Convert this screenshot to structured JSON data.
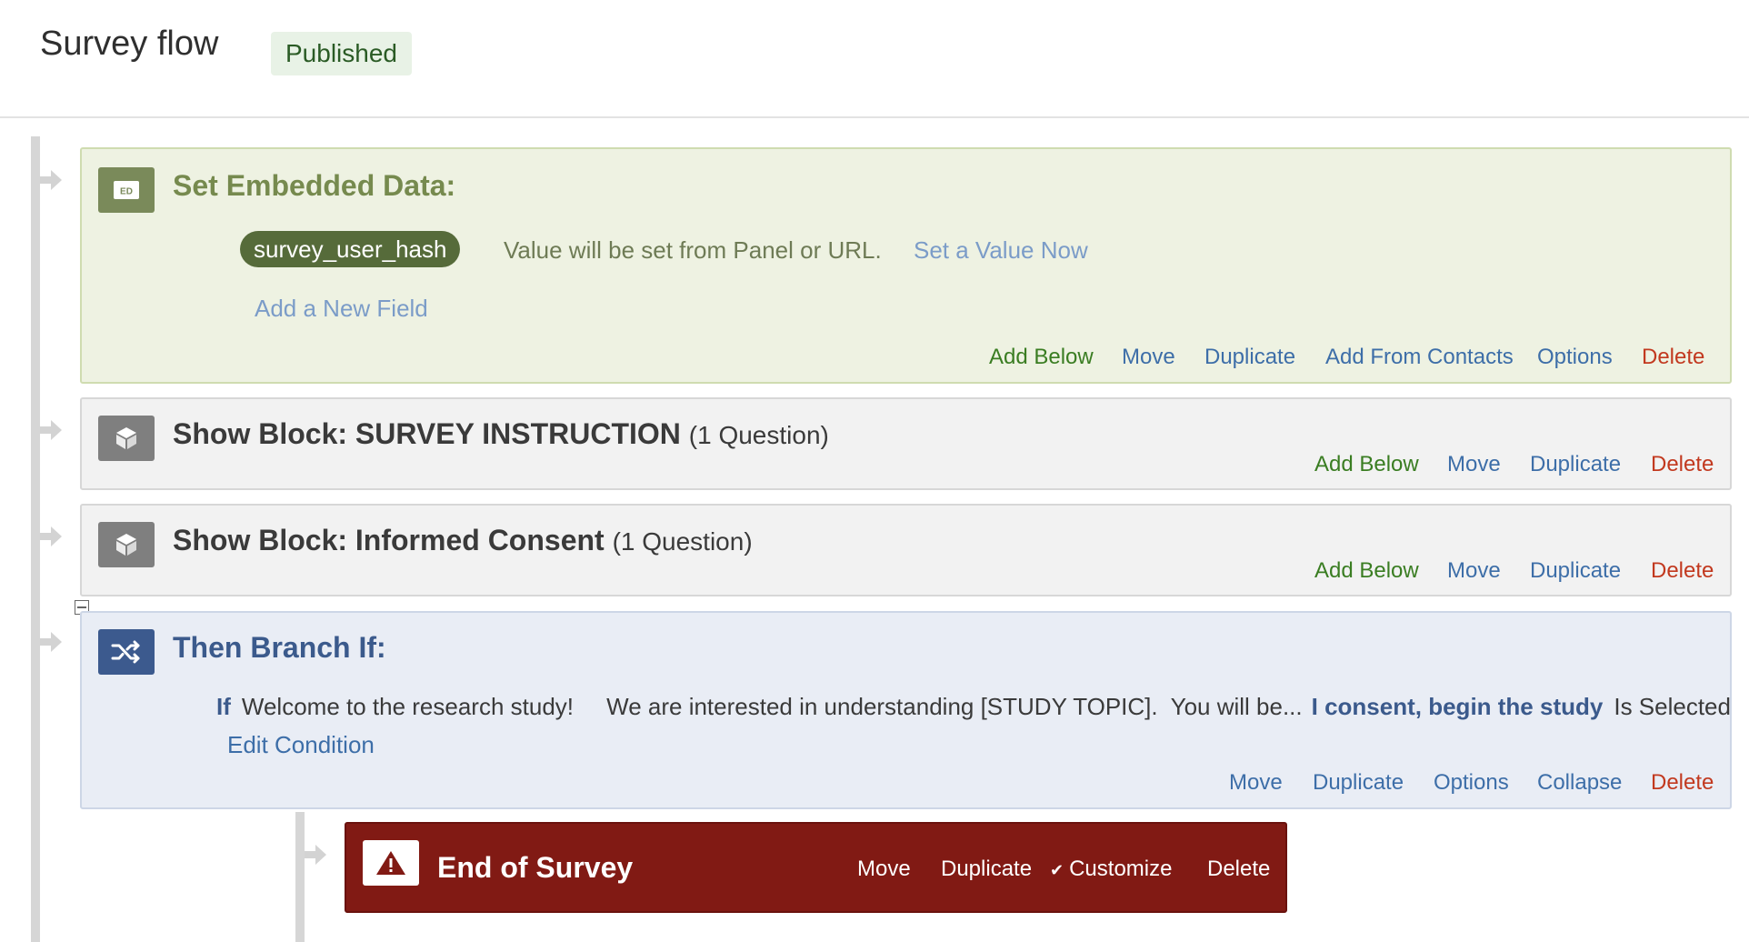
{
  "header": {
    "title": "Survey flow",
    "status": "Published"
  },
  "embedded_data": {
    "title": "Set Embedded Data:",
    "icon_label": "ED",
    "field_name": "survey_user_hash",
    "field_value_text": "Value will be set from Panel or URL.",
    "set_value_link": "Set a Value Now",
    "add_field_link": "Add a New Field",
    "actions": {
      "add_below": "Add Below",
      "move": "Move",
      "duplicate": "Duplicate",
      "add_from_contacts": "Add From Contacts",
      "options": "Options",
      "delete": "Delete"
    }
  },
  "block_instruction": {
    "title": "Show Block: SURVEY INSTRUCTION",
    "count": "(1 Question)",
    "actions": {
      "add_below": "Add Below",
      "move": "Move",
      "duplicate": "Duplicate",
      "delete": "Delete"
    }
  },
  "block_consent": {
    "title": "Show Block: Informed Consent",
    "count": "(1 Question)",
    "actions": {
      "add_below": "Add Below",
      "move": "Move",
      "duplicate": "Duplicate",
      "delete": "Delete"
    }
  },
  "branch": {
    "title": "Then Branch If:",
    "if_label": "If",
    "question_text": "Welcome to the research study!     We are interested in understanding [STUDY TOPIC].  You will be...",
    "answer": "I consent, begin the study",
    "condition": "Is Selected",
    "edit_condition": "Edit Condition",
    "actions": {
      "move": "Move",
      "duplicate": "Duplicate",
      "options": "Options",
      "collapse": "Collapse",
      "delete": "Delete"
    }
  },
  "end_of_survey": {
    "title": "End of Survey",
    "actions": {
      "move": "Move",
      "duplicate": "Duplicate",
      "customize": "Customize",
      "delete": "Delete"
    }
  },
  "colors": {
    "embedded_bg": "#eef2e2",
    "branch_bg": "#e9edf5",
    "end_bg": "#811a14",
    "delete_red": "#c2391f",
    "add_green": "#3a7d22",
    "link_blue": "#3d6ea8"
  }
}
